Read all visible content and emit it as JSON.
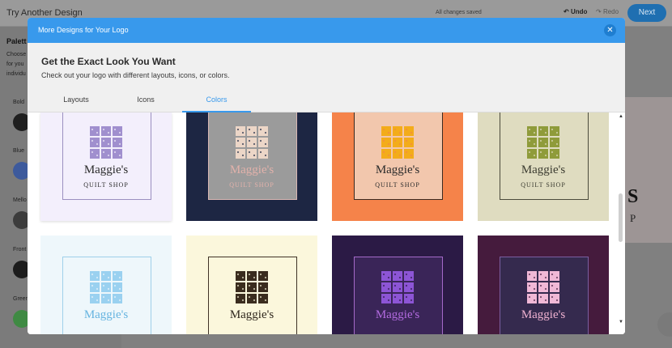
{
  "background": {
    "title": "Try Another Design",
    "saved_status": "All changes saved",
    "undo_label": "Undo",
    "redo_label": "Redo",
    "next_label": "Next",
    "sidebar": {
      "title": "Palett",
      "description": "Choose\nfor you\nindividu",
      "palettes": [
        {
          "label": "Bold",
          "color": "#1f1f1f"
        },
        {
          "label": "Blue",
          "color": "#3d5a9c"
        },
        {
          "label": "Mello",
          "color": "#3c3c3c"
        },
        {
          "label": "Front",
          "color": "#1c1c1c"
        },
        {
          "label": "Green",
          "color": "#3f8a43"
        }
      ]
    },
    "card": {
      "letter": "S",
      "letter2": "P"
    }
  },
  "modal": {
    "title": "More Designs for Your Logo",
    "close_icon": "close-icon",
    "heading": "Get the Exact Look You Want",
    "subheading": "Check out your logo with different layouts, icons, or colors.",
    "tabs": [
      {
        "label": "Layouts",
        "active": false
      },
      {
        "label": "Icons",
        "active": false
      },
      {
        "label": "Colors",
        "active": true
      }
    ],
    "accent": "#3899ec",
    "designs": [
      {
        "name": "Maggie's",
        "subtitle": "QUILT SHOP",
        "bg": "#f3effc",
        "frame": "#9b8fc0",
        "icon": "#a08fce",
        "name_color": "#2b2b2b",
        "sub_color": "#2b2b2b"
      },
      {
        "name": "Maggie's",
        "subtitle": "QUILT SHOP",
        "bg": "#1d2643",
        "frame": "#d9b7b3",
        "icon": "#ecd6c7",
        "panel": "#9b9b9b",
        "name_color": "#e3b2ab",
        "sub_color": "#e3b2ab"
      },
      {
        "name": "Maggie's",
        "subtitle": "QUILT SHOP",
        "bg": "#f5834a",
        "frame": "#3b2a20",
        "icon": "#f3ac1a",
        "panel": "#f2c7ad",
        "name_color": "#2b2b2b",
        "sub_color": "#2b2b2b"
      },
      {
        "name": "Maggie's",
        "subtitle": "QUILT SHOP",
        "bg": "#dfdcc0",
        "frame": "#4c4c3c",
        "icon": "#8f9b3a",
        "name_color": "#3b3b30",
        "sub_color": "#3b3b30"
      },
      {
        "name": "Maggie's",
        "subtitle": "",
        "bg": "#eef7fb",
        "frame": "#9fd0ea",
        "icon": "#9ad1f0",
        "name_color": "#66b4e0",
        "sub_color": "#66b4e0"
      },
      {
        "name": "Maggie's",
        "subtitle": "",
        "bg": "#fbf7dc",
        "frame": "#3f3326",
        "icon": "#3a2c1e",
        "name_color": "#2e261c",
        "sub_color": "#2e261c"
      },
      {
        "name": "Maggie's",
        "subtitle": "",
        "bg": "#2b1a45",
        "frame": "#a469c9",
        "icon": "#8d55d6",
        "panel": "#3a2558",
        "name_color": "#b36be0",
        "sub_color": "#b36be0"
      },
      {
        "name": "Maggie's",
        "subtitle": "",
        "bg": "#451b3d",
        "frame": "#7a5fa0",
        "icon": "#f0b8d6",
        "panel": "#352a4e",
        "name_color": "#f0b2d1",
        "sub_color": "#f0b2d1"
      }
    ]
  }
}
